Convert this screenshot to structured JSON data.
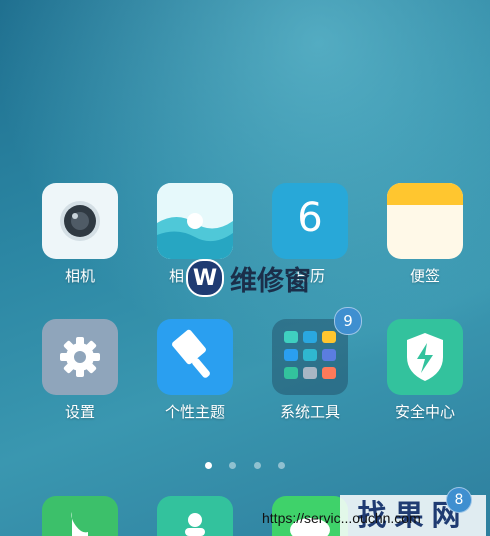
{
  "colors": {
    "camera_tile": "#e8f4f8",
    "gallery_tile": "#5fd3e0",
    "calendar_tile": "#28a8d8",
    "notes_tile": "#fff9e8",
    "settings_tile": "#8fa5bb",
    "themes_tile": "#2a9ff0",
    "security_tile": "#33c29d",
    "phone_tile": "#3cc06a",
    "badge": "#3f8fd0"
  },
  "apps_row1": {
    "camera_label": "相机",
    "gallery_label": "相",
    "calendar_day": "6",
    "calendar_label": "日历",
    "notes_label": "便签"
  },
  "apps_row2": {
    "settings_label": "设置",
    "themes_label": "个性主题",
    "tools_label": "系统工具",
    "tools_badge": "9",
    "security_label": "安全中心"
  },
  "dock_badge": "8",
  "page_indicator": {
    "current": 1,
    "total": 4
  },
  "watermarks": {
    "center_logo_letter": "W",
    "center_text": "维修窗",
    "bottom_right_text": "找果网",
    "url_text": "https://servic...ouchn.com"
  }
}
